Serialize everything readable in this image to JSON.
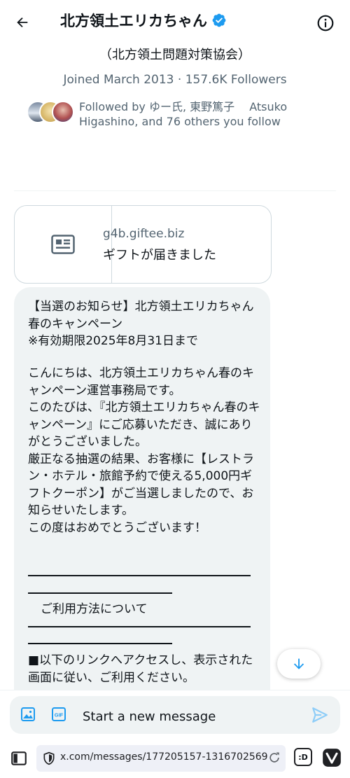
{
  "header": {
    "title": "北方領土エリカちゃん",
    "subtitle": "（北方領土問題対策協会）",
    "joined": "Joined March 2013 · 157.6K Followers",
    "followed_by": "Followed by ゆー氏, 東野篤子　 Atsuko Higashino, and 76 others you follow"
  },
  "link_card": {
    "domain": "g4b.giftee.biz",
    "title": "ギフトが届きました",
    "icon": "article-icon"
  },
  "message": {
    "p1": "【当選のお知らせ】北方領土エリカちゃん春のキャンペーン\n※有効期限2025年8月31日まで",
    "p2": "こんにちは、北方領土エリカちゃん春のキャンペーン運営事務局です。\nこのたびは、『北方領土エリカちゃん春のキャンペーン』にご応募いただき、誠にありがとうございました。\n厳正なる抽選の結果、お客様に【レストラン・ホテル・旅館予約で使える5,000円ギフトクーポン】がご当選しましたので、お知らせいたします。\nこの度はおめでとうございます！",
    "section_title": "ご利用方法について",
    "p3": "■以下のリンクへアクセスし、表示された画面に従い、ご利用ください。"
  },
  "composer": {
    "placeholder": "Start a new message"
  },
  "browser": {
    "url": "x.com/messages/177205157-1316702569",
    "smile_label": ":D"
  },
  "colors": {
    "accent": "#1d9bf0",
    "muted": "#536471",
    "bubble": "#eff3f4"
  }
}
